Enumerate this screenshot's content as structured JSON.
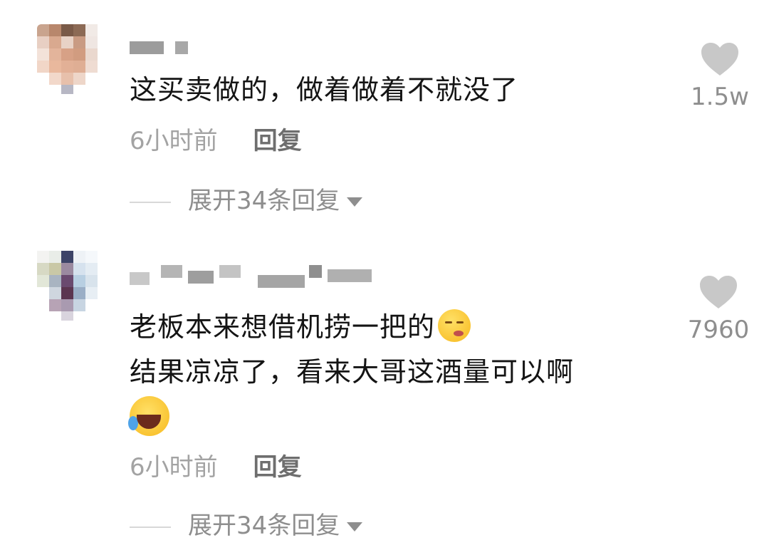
{
  "comments": [
    {
      "text_lines": [
        "这买卖做的，做着做着不就没了"
      ],
      "time": "6小时前",
      "reply_label": "回复",
      "expand_label": "展开34条回复",
      "like_count": "1.5w"
    },
    {
      "text_lines": [
        "老板本来想借机捞一把的",
        "结果凉凉了，看来大哥这酒量可以啊"
      ],
      "time": "6小时前",
      "reply_label": "回复",
      "expand_label": "展开34条回复",
      "like_count": "7960"
    }
  ],
  "colors": {
    "time": "#a3a3a3",
    "reply": "#6e6e6e",
    "expand": "#8e8e8e",
    "heart": "#c8c8c8"
  },
  "icons": [
    "heart-icon",
    "caret-down-icon",
    "shush-emoji-icon",
    "laughing-crying-emoji-icon"
  ]
}
